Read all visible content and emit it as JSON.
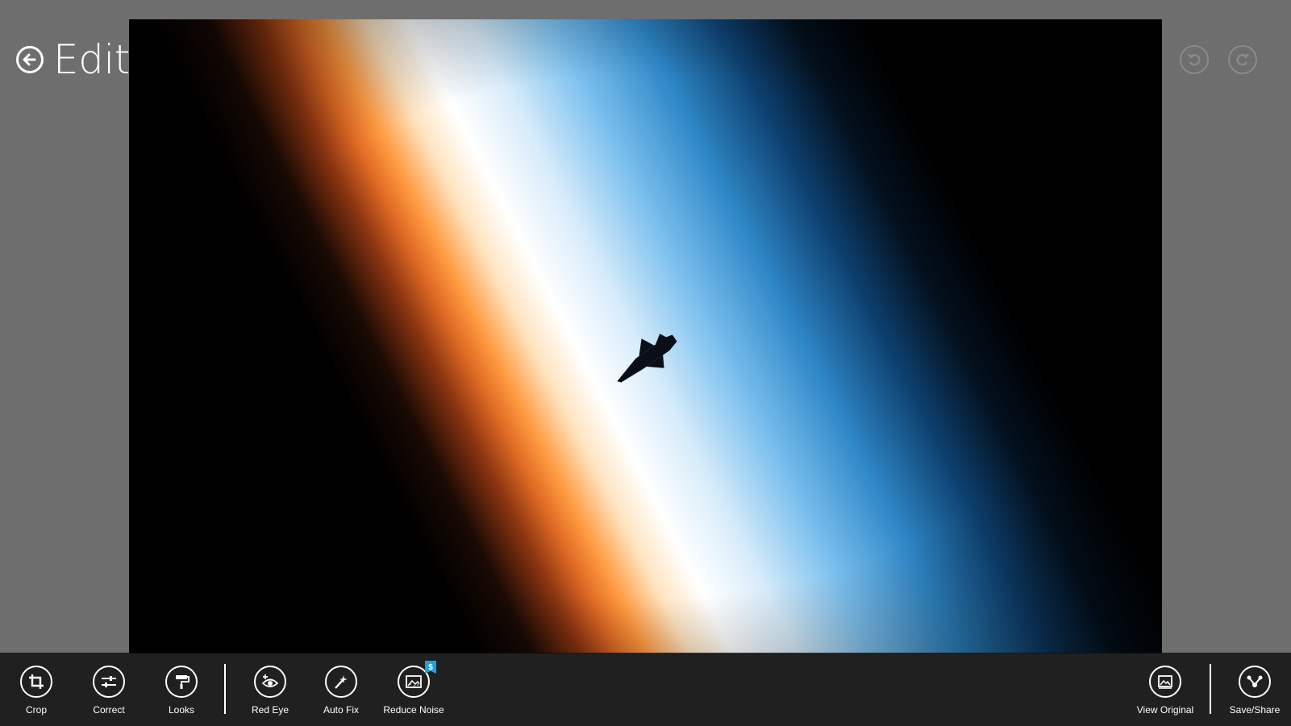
{
  "header": {
    "title": "Edit"
  },
  "toolbar": {
    "left": [
      {
        "id": "crop",
        "label": "Crop",
        "icon": "crop-icon"
      },
      {
        "id": "correct",
        "label": "Correct",
        "icon": "sliders-icon"
      },
      {
        "id": "looks",
        "label": "Looks",
        "icon": "paint-roller-icon"
      },
      {
        "id": "red-eye",
        "label": "Red Eye",
        "icon": "eye-icon"
      },
      {
        "id": "auto-fix",
        "label": "Auto Fix",
        "icon": "magic-wand-icon"
      },
      {
        "id": "reduce-noise",
        "label": "Reduce Noise",
        "icon": "image-icon",
        "badge": "$"
      }
    ],
    "right": [
      {
        "id": "view-original",
        "label": "View Original",
        "icon": "image-icon"
      },
      {
        "id": "save-share",
        "label": "Save/Share",
        "icon": "share-icon"
      }
    ]
  },
  "colors": {
    "background": "#6e6e6e",
    "appbar": "#0f0f0f",
    "badge": "#1ba1e2",
    "disabled": "#8a8a8a"
  }
}
